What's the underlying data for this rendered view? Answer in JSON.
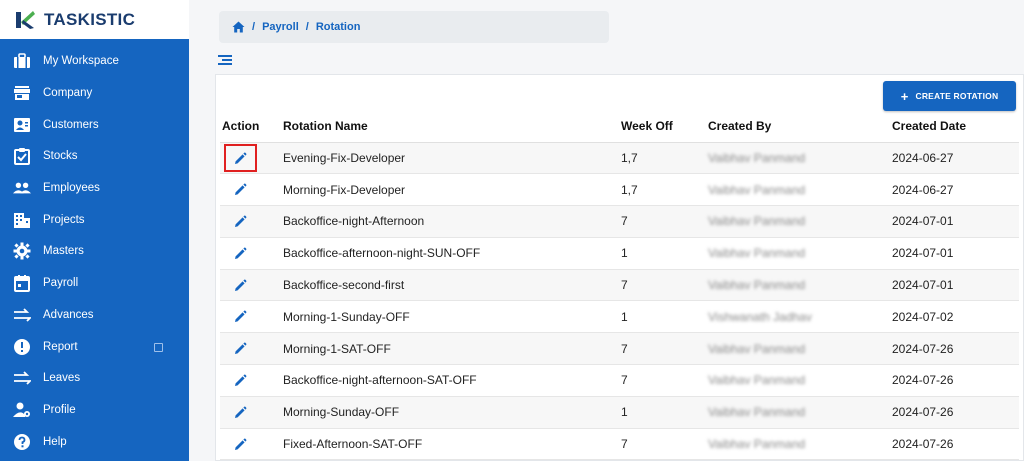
{
  "app": {
    "name": "TASKISTIC"
  },
  "sidebar": {
    "items": [
      {
        "label": "My Workspace",
        "icon": "briefcase-icon"
      },
      {
        "label": "Company",
        "icon": "store-icon"
      },
      {
        "label": "Customers",
        "icon": "contact-card-icon"
      },
      {
        "label": "Stocks",
        "icon": "clipboard-icon"
      },
      {
        "label": "Employees",
        "icon": "people-icon"
      },
      {
        "label": "Projects",
        "icon": "building-icon"
      },
      {
        "label": "Masters",
        "icon": "gear-icon"
      },
      {
        "label": "Payroll",
        "icon": "calendar-icon"
      },
      {
        "label": "Advances",
        "icon": "swap-arrows-icon"
      },
      {
        "label": "Report",
        "icon": "alert-circle-icon"
      },
      {
        "label": "Leaves",
        "icon": "swap-arrows-icon"
      },
      {
        "label": "Profile",
        "icon": "person-gear-icon"
      },
      {
        "label": "Help",
        "icon": "help-circle-icon"
      }
    ]
  },
  "breadcrumb": {
    "items": [
      "Payroll",
      "Rotation"
    ],
    "separator": "/"
  },
  "toolbar": {
    "create_label": "CREATE ROTATION"
  },
  "table": {
    "headers": {
      "action": "Action",
      "name": "Rotation Name",
      "week_off": "Week Off",
      "created_by": "Created By",
      "created_date": "Created Date"
    },
    "rows": [
      {
        "name": "Evening-Fix-Developer",
        "week_off": "1,7",
        "created_by": "Vaibhav Panmand",
        "created_date": "2024-06-27"
      },
      {
        "name": "Morning-Fix-Developer",
        "week_off": "1,7",
        "created_by": "Vaibhav Panmand",
        "created_date": "2024-06-27"
      },
      {
        "name": "Backoffice-night-Afternoon",
        "week_off": "7",
        "created_by": "Vaibhav Panmand",
        "created_date": "2024-07-01"
      },
      {
        "name": "Backoffice-afternoon-night-SUN-OFF",
        "week_off": "1",
        "created_by": "Vaibhav Panmand",
        "created_date": "2024-07-01"
      },
      {
        "name": "Backoffice-second-first",
        "week_off": "7",
        "created_by": "Vaibhav Panmand",
        "created_date": "2024-07-01"
      },
      {
        "name": "Morning-1-Sunday-OFF",
        "week_off": "1",
        "created_by": "Vishwanath Jadhav",
        "created_date": "2024-07-02"
      },
      {
        "name": "Morning-1-SAT-OFF",
        "week_off": "7",
        "created_by": "Vaibhav Panmand",
        "created_date": "2024-07-26"
      },
      {
        "name": "Backoffice-night-afternoon-SAT-OFF",
        "week_off": "7",
        "created_by": "Vaibhav Panmand",
        "created_date": "2024-07-26"
      },
      {
        "name": "Morning-Sunday-OFF",
        "week_off": "1",
        "created_by": "Vaibhav Panmand",
        "created_date": "2024-07-26"
      },
      {
        "name": "Fixed-Afternoon-SAT-OFF",
        "week_off": "7",
        "created_by": "Vaibhav Panmand",
        "created_date": "2024-07-26"
      }
    ]
  },
  "colors": {
    "primary": "#1565c0",
    "highlight": "#e02020",
    "logo_green": "#4caf50"
  }
}
